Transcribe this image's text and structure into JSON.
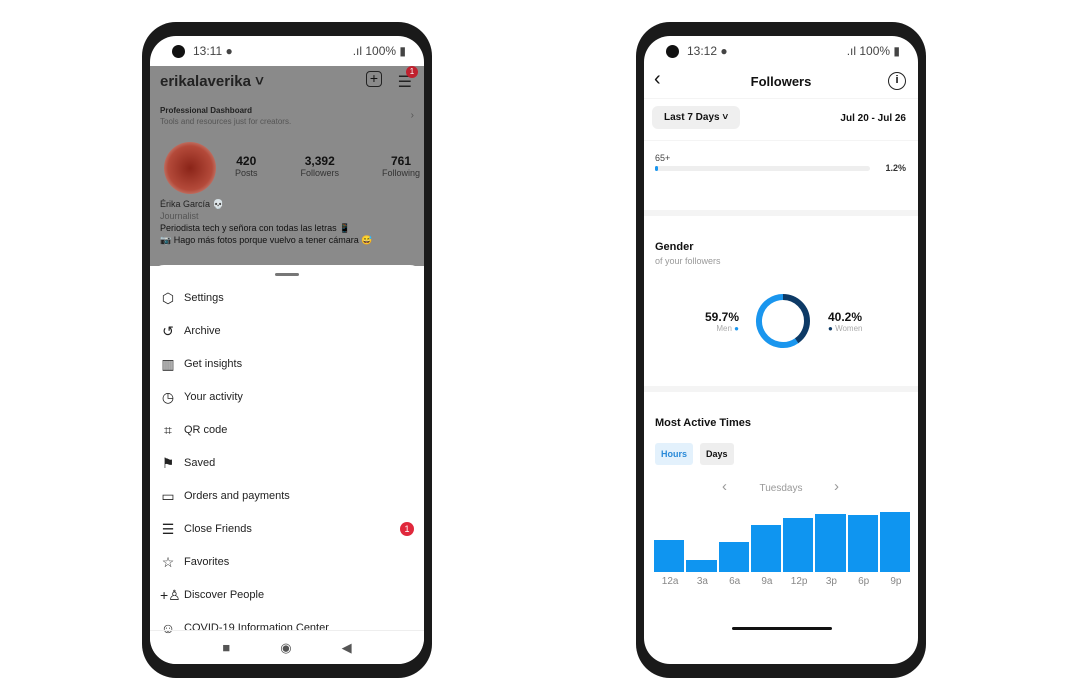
{
  "left": {
    "status": {
      "time": "13:11",
      "battery": "100%"
    },
    "username": "erikalaverika",
    "menu_badge": "1",
    "dashboard": {
      "title": "Professional Dashboard",
      "subtitle": "Tools and resources just for creators."
    },
    "stats": [
      {
        "value": "420",
        "label": "Posts"
      },
      {
        "value": "3,392",
        "label": "Followers"
      },
      {
        "value": "761",
        "label": "Following"
      }
    ],
    "name": "Érika García 💀",
    "category": "Journalist",
    "bio": [
      "Periodista tech y señora con todas las letras 📱",
      "📷 Hago más fotos porque vuelvo a tener cámara 😅"
    ],
    "menu": [
      {
        "label": "Settings",
        "icon": "settings-icon"
      },
      {
        "label": "Archive",
        "icon": "archive-icon"
      },
      {
        "label": "Get insights",
        "icon": "insights-icon"
      },
      {
        "label": "Your activity",
        "icon": "activity-icon"
      },
      {
        "label": "QR code",
        "icon": "qr-code-icon"
      },
      {
        "label": "Saved",
        "icon": "bookmark-icon"
      },
      {
        "label": "Orders and payments",
        "icon": "card-icon"
      },
      {
        "label": "Close Friends",
        "icon": "list-icon",
        "badge": "1"
      },
      {
        "label": "Favorites",
        "icon": "star-icon"
      },
      {
        "label": "Discover People",
        "icon": "add-person-icon"
      },
      {
        "label": "COVID-19 Information Center",
        "icon": "covid-info-icon"
      }
    ]
  },
  "right": {
    "status": {
      "time": "13:12",
      "battery": "100%"
    },
    "title": "Followers",
    "range": "Last 7 Days",
    "dates": "Jul 20 - Jul 26",
    "age": {
      "label": "65+",
      "value": "1.2%",
      "fraction": 0.012
    },
    "gender": {
      "title": "Gender",
      "subtitle": "of your followers",
      "men": {
        "value": "59.7%",
        "label": "Men"
      },
      "women": {
        "value": "40.2%",
        "label": "Women"
      },
      "colors": {
        "men": "#1a96ee",
        "women": "#0d3a66"
      }
    },
    "active": {
      "title": "Most Active Times",
      "tabs": [
        "Hours",
        "Days"
      ],
      "selected_tab": "Hours",
      "day": "Tuesdays"
    }
  },
  "chart_data": {
    "type": "bar",
    "categories": [
      "12a",
      "3a",
      "6a",
      "9a",
      "12p",
      "3p",
      "6p",
      "9p"
    ],
    "values": [
      29,
      11,
      27,
      43,
      49,
      53,
      52,
      55
    ],
    "color": "#0f95f0"
  }
}
